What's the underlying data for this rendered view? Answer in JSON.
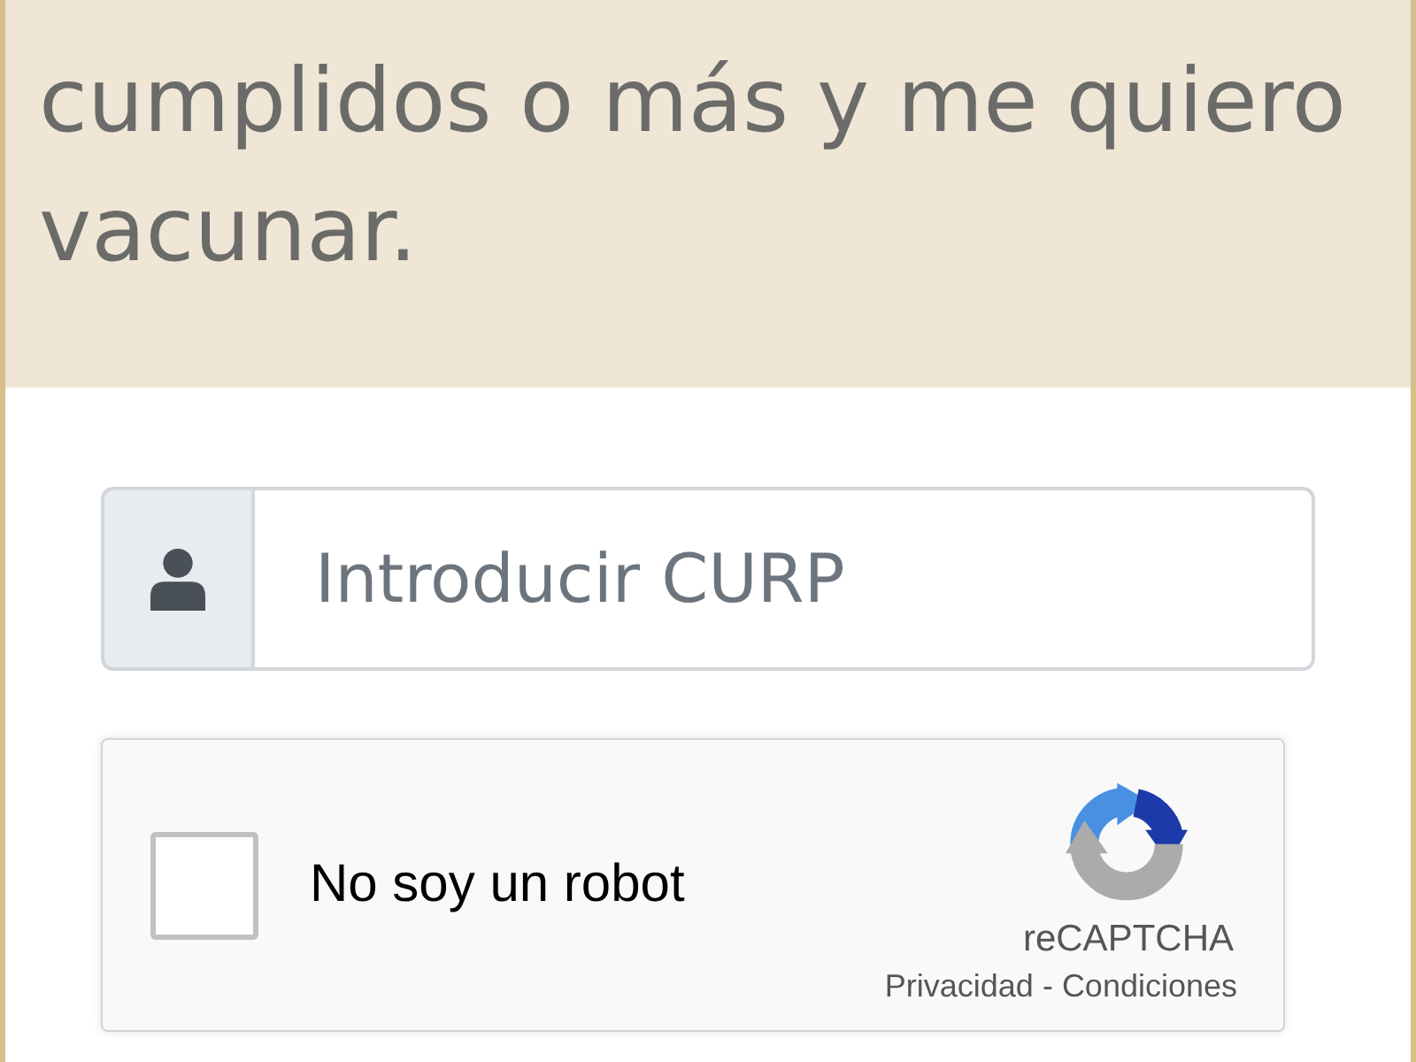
{
  "banner": {
    "text": "cumplidos o más y me quiero vacunar."
  },
  "curp_field": {
    "placeholder": "Introducir CURP"
  },
  "captcha": {
    "checked": false,
    "label": "No soy un robot",
    "brand": "reCAPTCHA",
    "links": [
      "Privacidad",
      "Condiciones"
    ],
    "separator": "-"
  }
}
